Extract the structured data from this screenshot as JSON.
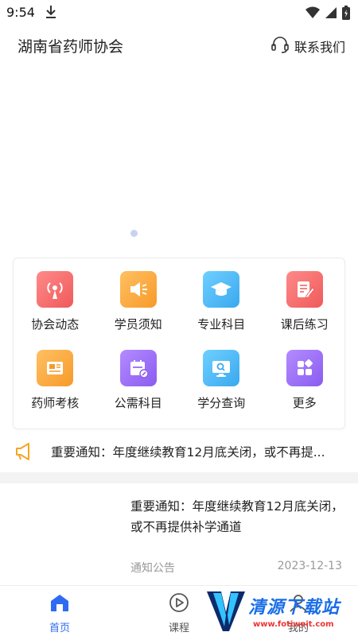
{
  "status_bar": {
    "time": "9:54",
    "icons": [
      "download-icon",
      "wifi-icon",
      "signal-icon",
      "battery-icon"
    ]
  },
  "header": {
    "title": "湖南省药师协会",
    "contact_label": "联系我们",
    "contact_icon": "headset-icon"
  },
  "banner": {
    "indicator_count": 1
  },
  "grid": {
    "items": [
      {
        "label": "协会动态",
        "icon": "broadcast-icon",
        "color": "#f26d6d"
      },
      {
        "label": "学员须知",
        "icon": "speaker-icon",
        "color": "#f9a23c"
      },
      {
        "label": "专业科目",
        "icon": "graduation-cap-icon",
        "color": "#49b6f2"
      },
      {
        "label": "课后练习",
        "icon": "edit-doc-icon",
        "color": "#f26d6d"
      },
      {
        "label": "药师考核",
        "icon": "newspaper-icon",
        "color": "#f9a23c"
      },
      {
        "label": "公需科目",
        "icon": "calendar-edit-icon",
        "color": "#9b6cf2"
      },
      {
        "label": "学分查询",
        "icon": "monitor-search-icon",
        "color": "#49b6f2"
      },
      {
        "label": "更多",
        "icon": "grid-more-icon",
        "color": "#9b6cf2"
      }
    ]
  },
  "notice": {
    "icon": "megaphone-icon",
    "text": "重要通知：年度继续教育12月底关闭，或不再提..."
  },
  "article": {
    "title": "重要通知：年度继续教育12月底关闭，或不再提供补学通道",
    "category": "通知公告",
    "date": "2023-12-13"
  },
  "tabbar": {
    "tabs": [
      {
        "label": "首页",
        "icon": "home-icon",
        "active": true
      },
      {
        "label": "课程",
        "icon": "play-icon",
        "active": false
      },
      {
        "label": "我的",
        "icon": "user-icon",
        "active": false
      }
    ]
  },
  "watermark": {
    "text": "清源下载站",
    "url": "www.fotiweit.com"
  },
  "colors": {
    "accent": "#2f6bf2",
    "notice_icon": "#f5a623",
    "muted_text": "#999999"
  }
}
